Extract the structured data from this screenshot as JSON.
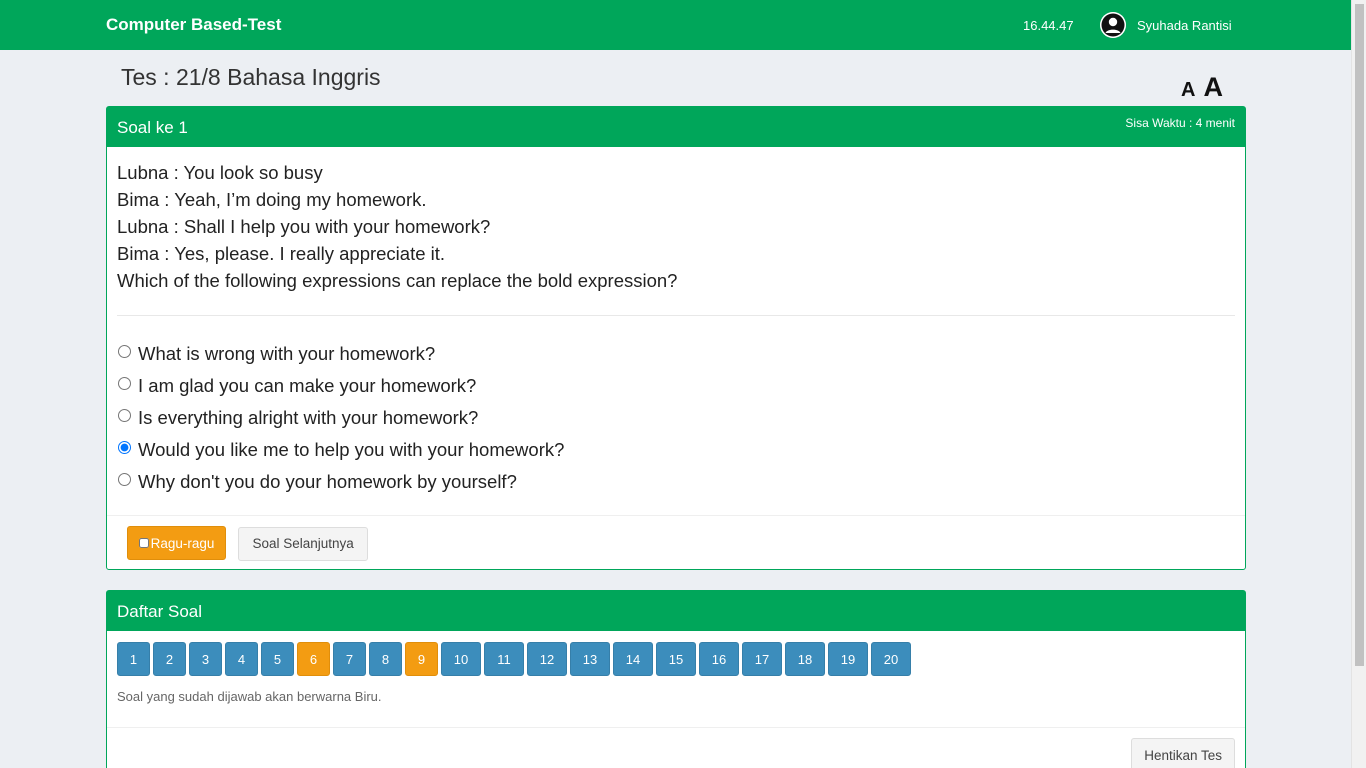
{
  "app": {
    "title": "Computer Based-Test",
    "clock": "16.44.47",
    "user_name": "Syuhada Rantisi"
  },
  "page": {
    "title": "Tes : 21/8 Bahasa Inggris",
    "font_small_label": "A",
    "font_large_label": "A"
  },
  "question": {
    "header": "Soal ke 1",
    "timer": "Sisa Waktu : 4 menit",
    "lines": [
      "Lubna : You look so busy",
      "Bima : Yeah, I’m doing my homework.",
      "Lubna : Shall I help you with your homework?",
      "Bima : Yes, please. I really appreciate it.",
      "Which of the following expressions can replace the bold expression?"
    ],
    "options": [
      {
        "label": "What is wrong with your homework?",
        "selected": false
      },
      {
        "label": "I am glad you can make your homework?",
        "selected": false
      },
      {
        "label": "Is everything alright with your homework?",
        "selected": false
      },
      {
        "label": "Would you like me to help you with your homework?",
        "selected": true
      },
      {
        "label": "Why don't you do your homework by yourself?",
        "selected": false
      }
    ],
    "doubt_label": "Ragu-ragu",
    "next_label": "Soal Selanjutnya"
  },
  "question_list": {
    "header": "Daftar Soal",
    "numbers": [
      "1",
      "2",
      "3",
      "4",
      "5",
      "6",
      "7",
      "8",
      "9",
      "10",
      "11",
      "12",
      "13",
      "14",
      "15",
      "16",
      "17",
      "18",
      "19",
      "20"
    ],
    "doubtful": [
      "6",
      "9"
    ],
    "help_text": "Soal yang sudah dijawab akan berwarna Biru.",
    "stop_label": "Hentikan Tes"
  },
  "colors": {
    "primary_green": "#00a65a",
    "answered_blue": "#3c8dbc",
    "doubtful_orange": "#f39c12"
  }
}
